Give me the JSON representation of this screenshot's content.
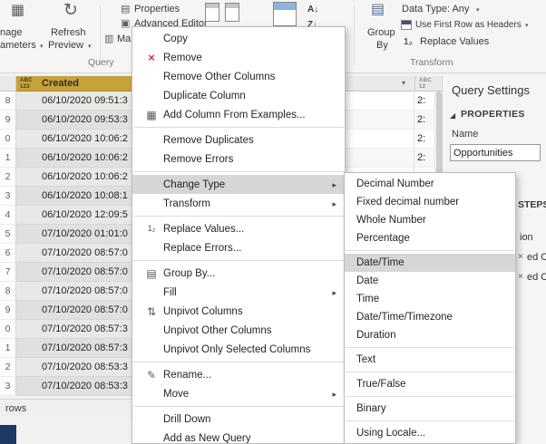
{
  "colors": {
    "selected_column_header": "#c7a238",
    "menu_highlight": "#d6d6d6",
    "remove_red": "#d13438",
    "bottom_left_square": "#1f3864",
    "panel_background": "#f6f5f4"
  },
  "ribbon": {
    "manage_parameters_line1": "nage",
    "manage_parameters_line2": "ameters",
    "refresh_line1": "Refresh",
    "refresh_line2": "Preview",
    "properties": "Properties",
    "advanced_editor": "Advanced Editor",
    "manage_truncated": "Mana",
    "query_group": "Query",
    "transform_group": "Transform",
    "group_by_line1": "Group",
    "group_by_line2": "By",
    "data_type": "Data Type: Any",
    "use_first_row": "Use First Row as Headers",
    "replace_values": "Replace Values"
  },
  "grid": {
    "created_header": "Created",
    "type_icon_line1": "ABC",
    "type_icon_line2": "123",
    "col3_icon_line1": "ABC",
    "col3_icon_line2": "12",
    "footer": "rows",
    "rows": [
      {
        "n": "8",
        "created": "06/10/2020 09:51:3",
        "right": "2:"
      },
      {
        "n": "9",
        "created": "06/10/2020 09:53:3",
        "right": "2:"
      },
      {
        "n": "0",
        "created": "06/10/2020 10:06:2",
        "right": "2:"
      },
      {
        "n": "1",
        "created": "06/10/2020 10:06:2",
        "right": "2:"
      },
      {
        "n": "2",
        "created": "06/10/2020 10:06:2",
        "right": ""
      },
      {
        "n": "3",
        "created": "06/10/2020 10:08:1",
        "right": ""
      },
      {
        "n": "4",
        "created": "06/10/2020 12:09:5",
        "right": ""
      },
      {
        "n": "5",
        "created": "07/10/2020 01:01:0",
        "right": ""
      },
      {
        "n": "6",
        "created": "07/10/2020 08:57:0",
        "right": ""
      },
      {
        "n": "7",
        "created": "07/10/2020 08:57:0",
        "right": ""
      },
      {
        "n": "8",
        "created": "07/10/2020 08:57:0",
        "right": ""
      },
      {
        "n": "9",
        "created": "07/10/2020 08:57:0",
        "right": ""
      },
      {
        "n": "0",
        "created": "07/10/2020 08:57:3",
        "right": ""
      },
      {
        "n": "1",
        "created": "07/10/2020 08:57:3",
        "right": ""
      },
      {
        "n": "2",
        "created": "07/10/2020 08:53:3",
        "right": ""
      },
      {
        "n": "3",
        "created": "07/10/2020 08:53:3",
        "right": ""
      }
    ]
  },
  "menu": {
    "copy": "Copy",
    "remove": "Remove",
    "remove_other_columns": "Remove Other Columns",
    "duplicate_column": "Duplicate Column",
    "add_column_from_examples": "Add Column From Examples...",
    "remove_duplicates": "Remove Duplicates",
    "remove_errors": "Remove Errors",
    "change_type": "Change Type",
    "transform": "Transform",
    "replace_values": "Replace Values...",
    "replace_errors": "Replace Errors...",
    "group_by": "Group By...",
    "fill": "Fill",
    "unpivot_columns": "Unpivot Columns",
    "unpivot_other_columns": "Unpivot Other Columns",
    "unpivot_only_selected": "Unpivot Only Selected Columns",
    "rename": "Rename...",
    "move": "Move",
    "drill_down": "Drill Down",
    "add_as_new_query": "Add as New Query"
  },
  "submenu": {
    "decimal_number": "Decimal Number",
    "fixed_decimal": "Fixed decimal number",
    "whole_number": "Whole Number",
    "percentage": "Percentage",
    "date_time": "Date/Time",
    "date": "Date",
    "time": "Time",
    "date_time_timezone": "Date/Time/Timezone",
    "duration": "Duration",
    "text": "Text",
    "true_false": "True/False",
    "binary": "Binary",
    "using_locale": "Using Locale..."
  },
  "query_settings": {
    "title": "Query Settings",
    "properties": "PROPERTIES",
    "name_label": "Name",
    "name_value": "Opportunities",
    "steps_header_fragment": "STEPS",
    "step_fragments": [
      "ion",
      "ed Col",
      "ed Col"
    ]
  },
  "icons": {
    "dropdown": "▾",
    "submenu_arrow": "▸",
    "remove_x": "×",
    "refresh": "↻",
    "properties_doc": "▤",
    "advanced_editor": "▣",
    "manage": "▥",
    "manage_parameters": "▦",
    "add_column": "▦",
    "replace_values_12": "1₂",
    "group_by_menu": "▤",
    "group_by_big": "▤",
    "unpivot": "⇅",
    "rename_pencil": "✎",
    "sort_asc": "A↓",
    "sort_desc": "Z↓",
    "properties_expander": "◢",
    "step_delete": "×"
  }
}
